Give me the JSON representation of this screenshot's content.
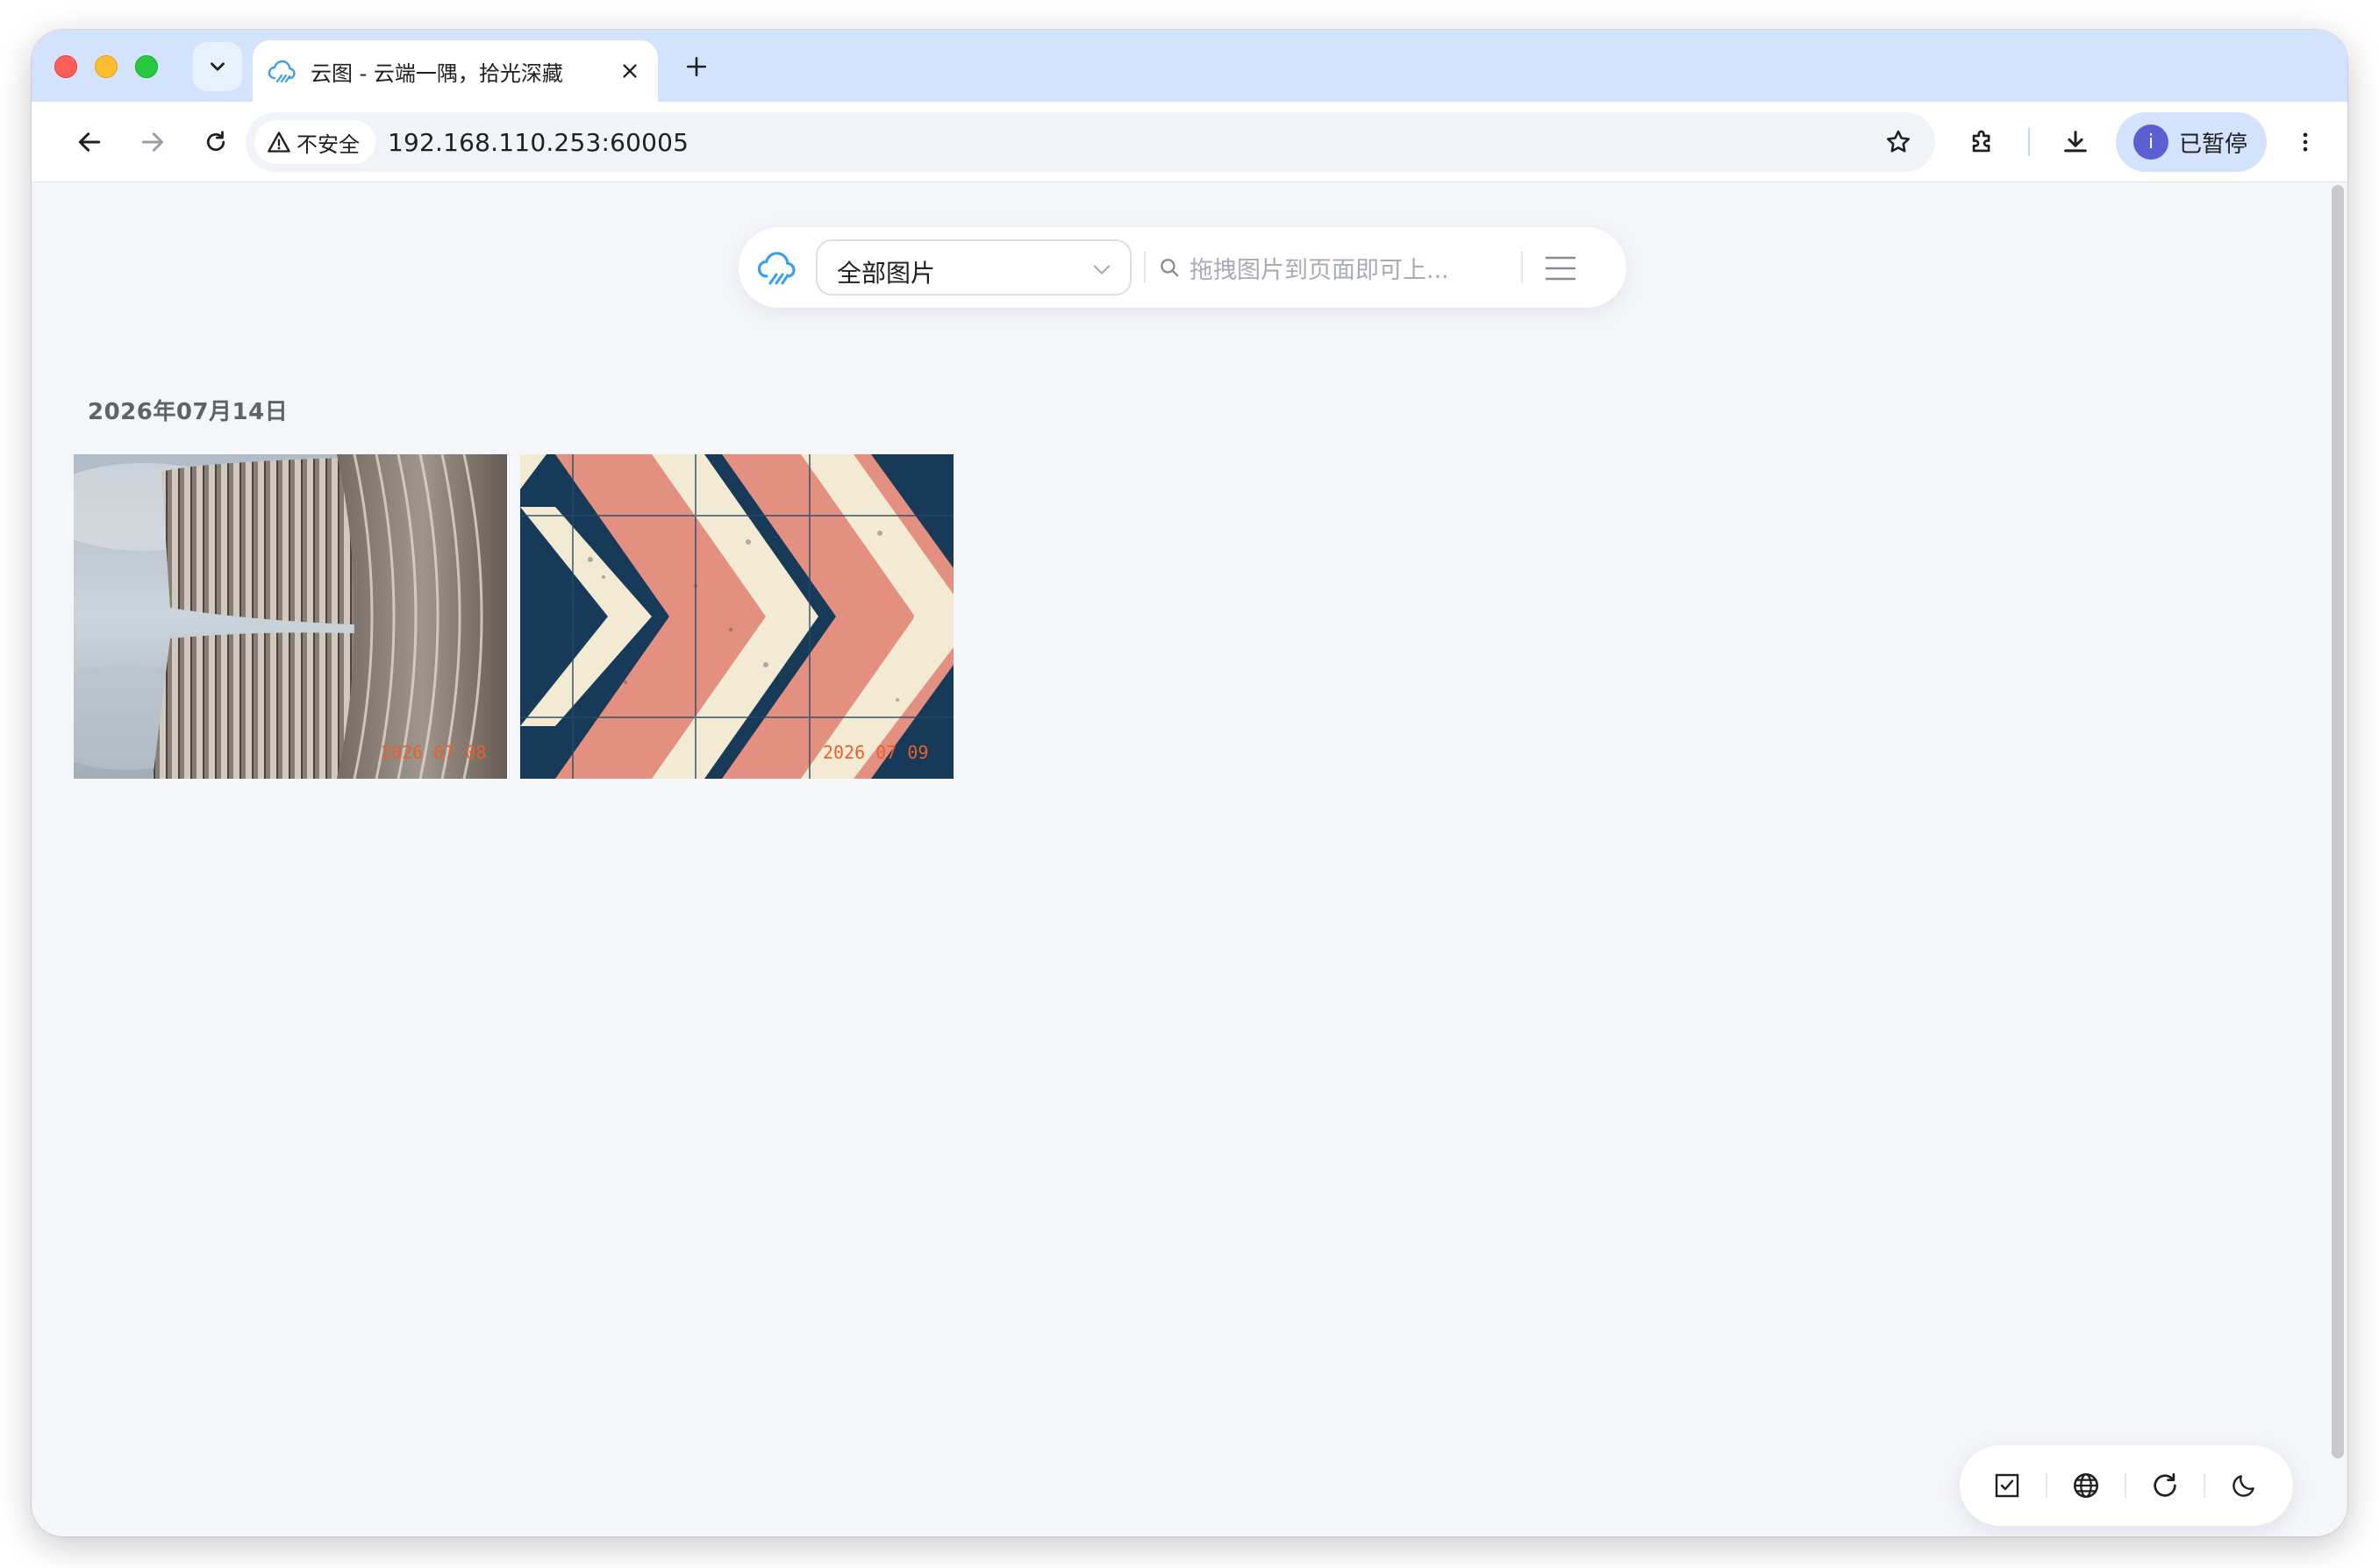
{
  "browser": {
    "tab_title": "云图 - 云端一隅，拾光深藏",
    "security_label": "不安全",
    "url": "192.168.110.253:60005",
    "profile_initial": "i",
    "profile_status": "已暂停"
  },
  "app": {
    "filter_selected": "全部图片",
    "search_placeholder": "拖拽图片到页面即可上...",
    "accent_color": "#3aa0e8"
  },
  "gallery": {
    "groups": [
      {
        "date": "2026年07月14日",
        "photos": [
          {
            "stamp": "2026 07 08"
          },
          {
            "stamp": "2026 07 09"
          }
        ]
      }
    ]
  }
}
